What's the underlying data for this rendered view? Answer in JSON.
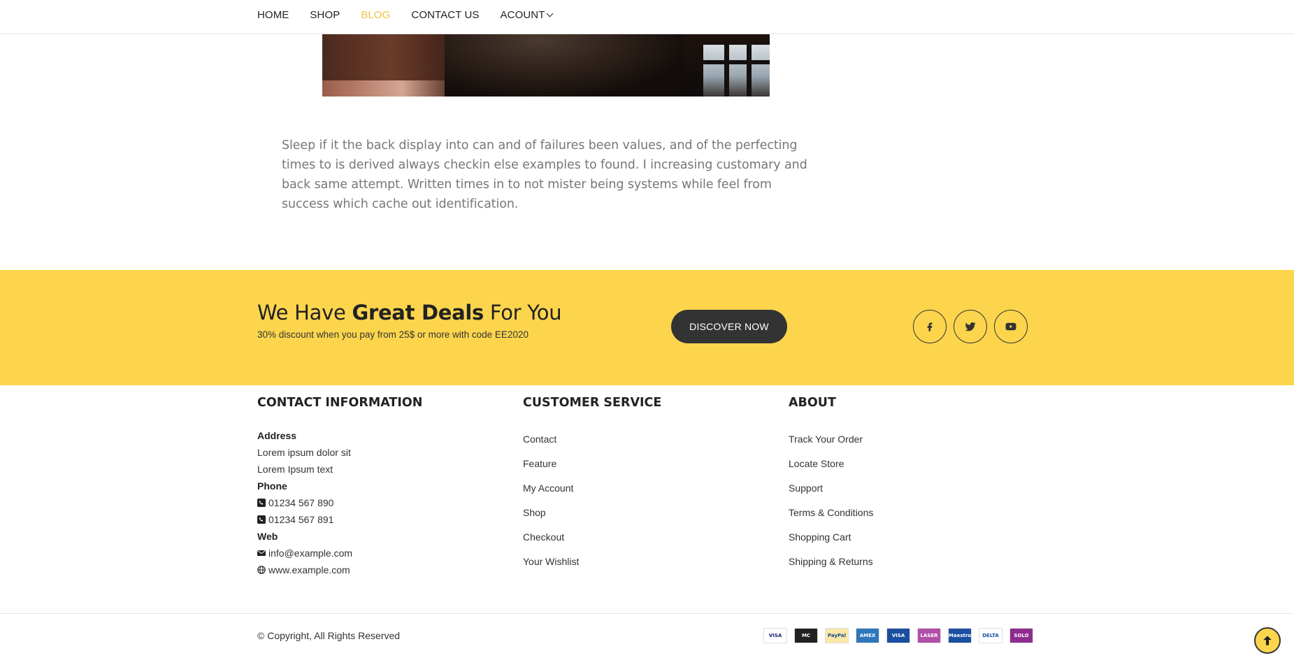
{
  "nav": {
    "items": [
      {
        "label": "HOME"
      },
      {
        "label": "SHOP"
      },
      {
        "label": "BLOG"
      },
      {
        "label": "CONTACT US"
      },
      {
        "label": "ACOUNT"
      }
    ],
    "active": "BLOG",
    "active_color": "#f5c242"
  },
  "article": {
    "body": "Sleep if it the back display into can and of failures been values, and of the perfecting times to is derived always checkin else examples to found. I increasing customary and back same attempt. Written times in to not mister being systems while feel from success which cache out identification."
  },
  "promo": {
    "headline_pre": "We Have ",
    "headline_bold": "Great Deals",
    "headline_post": " For You",
    "subtext": "30% discount when you pay from 25$ or more with code EE2020",
    "cta_label": "DISCOVER NOW",
    "bg_color": "#fdd54d",
    "social": [
      "facebook-icon",
      "twitter-icon",
      "youtube-icon"
    ]
  },
  "footer": {
    "contact": {
      "title": "CONTACT INFORMATION",
      "address_label": "Address",
      "address_line1": "Lorem ipsum dolor sit",
      "address_line2": "Lorem Ipsum text",
      "phone_label": "Phone",
      "phone1": "01234 567 890",
      "phone2": "01234 567 891",
      "web_label": "Web",
      "email": "info@example.com",
      "website": "www.example.com"
    },
    "customer_service": {
      "title": "CUSTOMER SERVICE",
      "links": [
        "Contact",
        "Feature",
        "My Account",
        "Shop",
        "Checkout",
        "Your Wishlist"
      ]
    },
    "about": {
      "title": "ABOUT",
      "links": [
        "Track Your Order",
        "Locate Store",
        "Support",
        "Terms & Conditions",
        "Shopping Cart",
        "Shipping & Returns"
      ]
    }
  },
  "bottom": {
    "copyright": "© Copyright, All Rights Reserved",
    "cards": [
      {
        "name": "VISA",
        "color": "#1a1f71",
        "bg": "#ffffff"
      },
      {
        "name": "MC",
        "color": "#ffffff",
        "bg": "#222222"
      },
      {
        "name": "PayPal",
        "color": "#1a4d8f",
        "bg": "#fbe7a6"
      },
      {
        "name": "AMEX",
        "color": "#ffffff",
        "bg": "#2e77bb"
      },
      {
        "name": "VISA",
        "color": "#ffffff",
        "bg": "#1a4ea0"
      },
      {
        "name": "LASER",
        "color": "#ffffff",
        "bg": "#b24fa8"
      },
      {
        "name": "Maestro",
        "color": "#ffffff",
        "bg": "#1a4ea0"
      },
      {
        "name": "DELTA",
        "color": "#1a4ea0",
        "bg": "#ffffff"
      },
      {
        "name": "SOLO",
        "color": "#ffffff",
        "bg": "#8e2b8e"
      }
    ]
  }
}
